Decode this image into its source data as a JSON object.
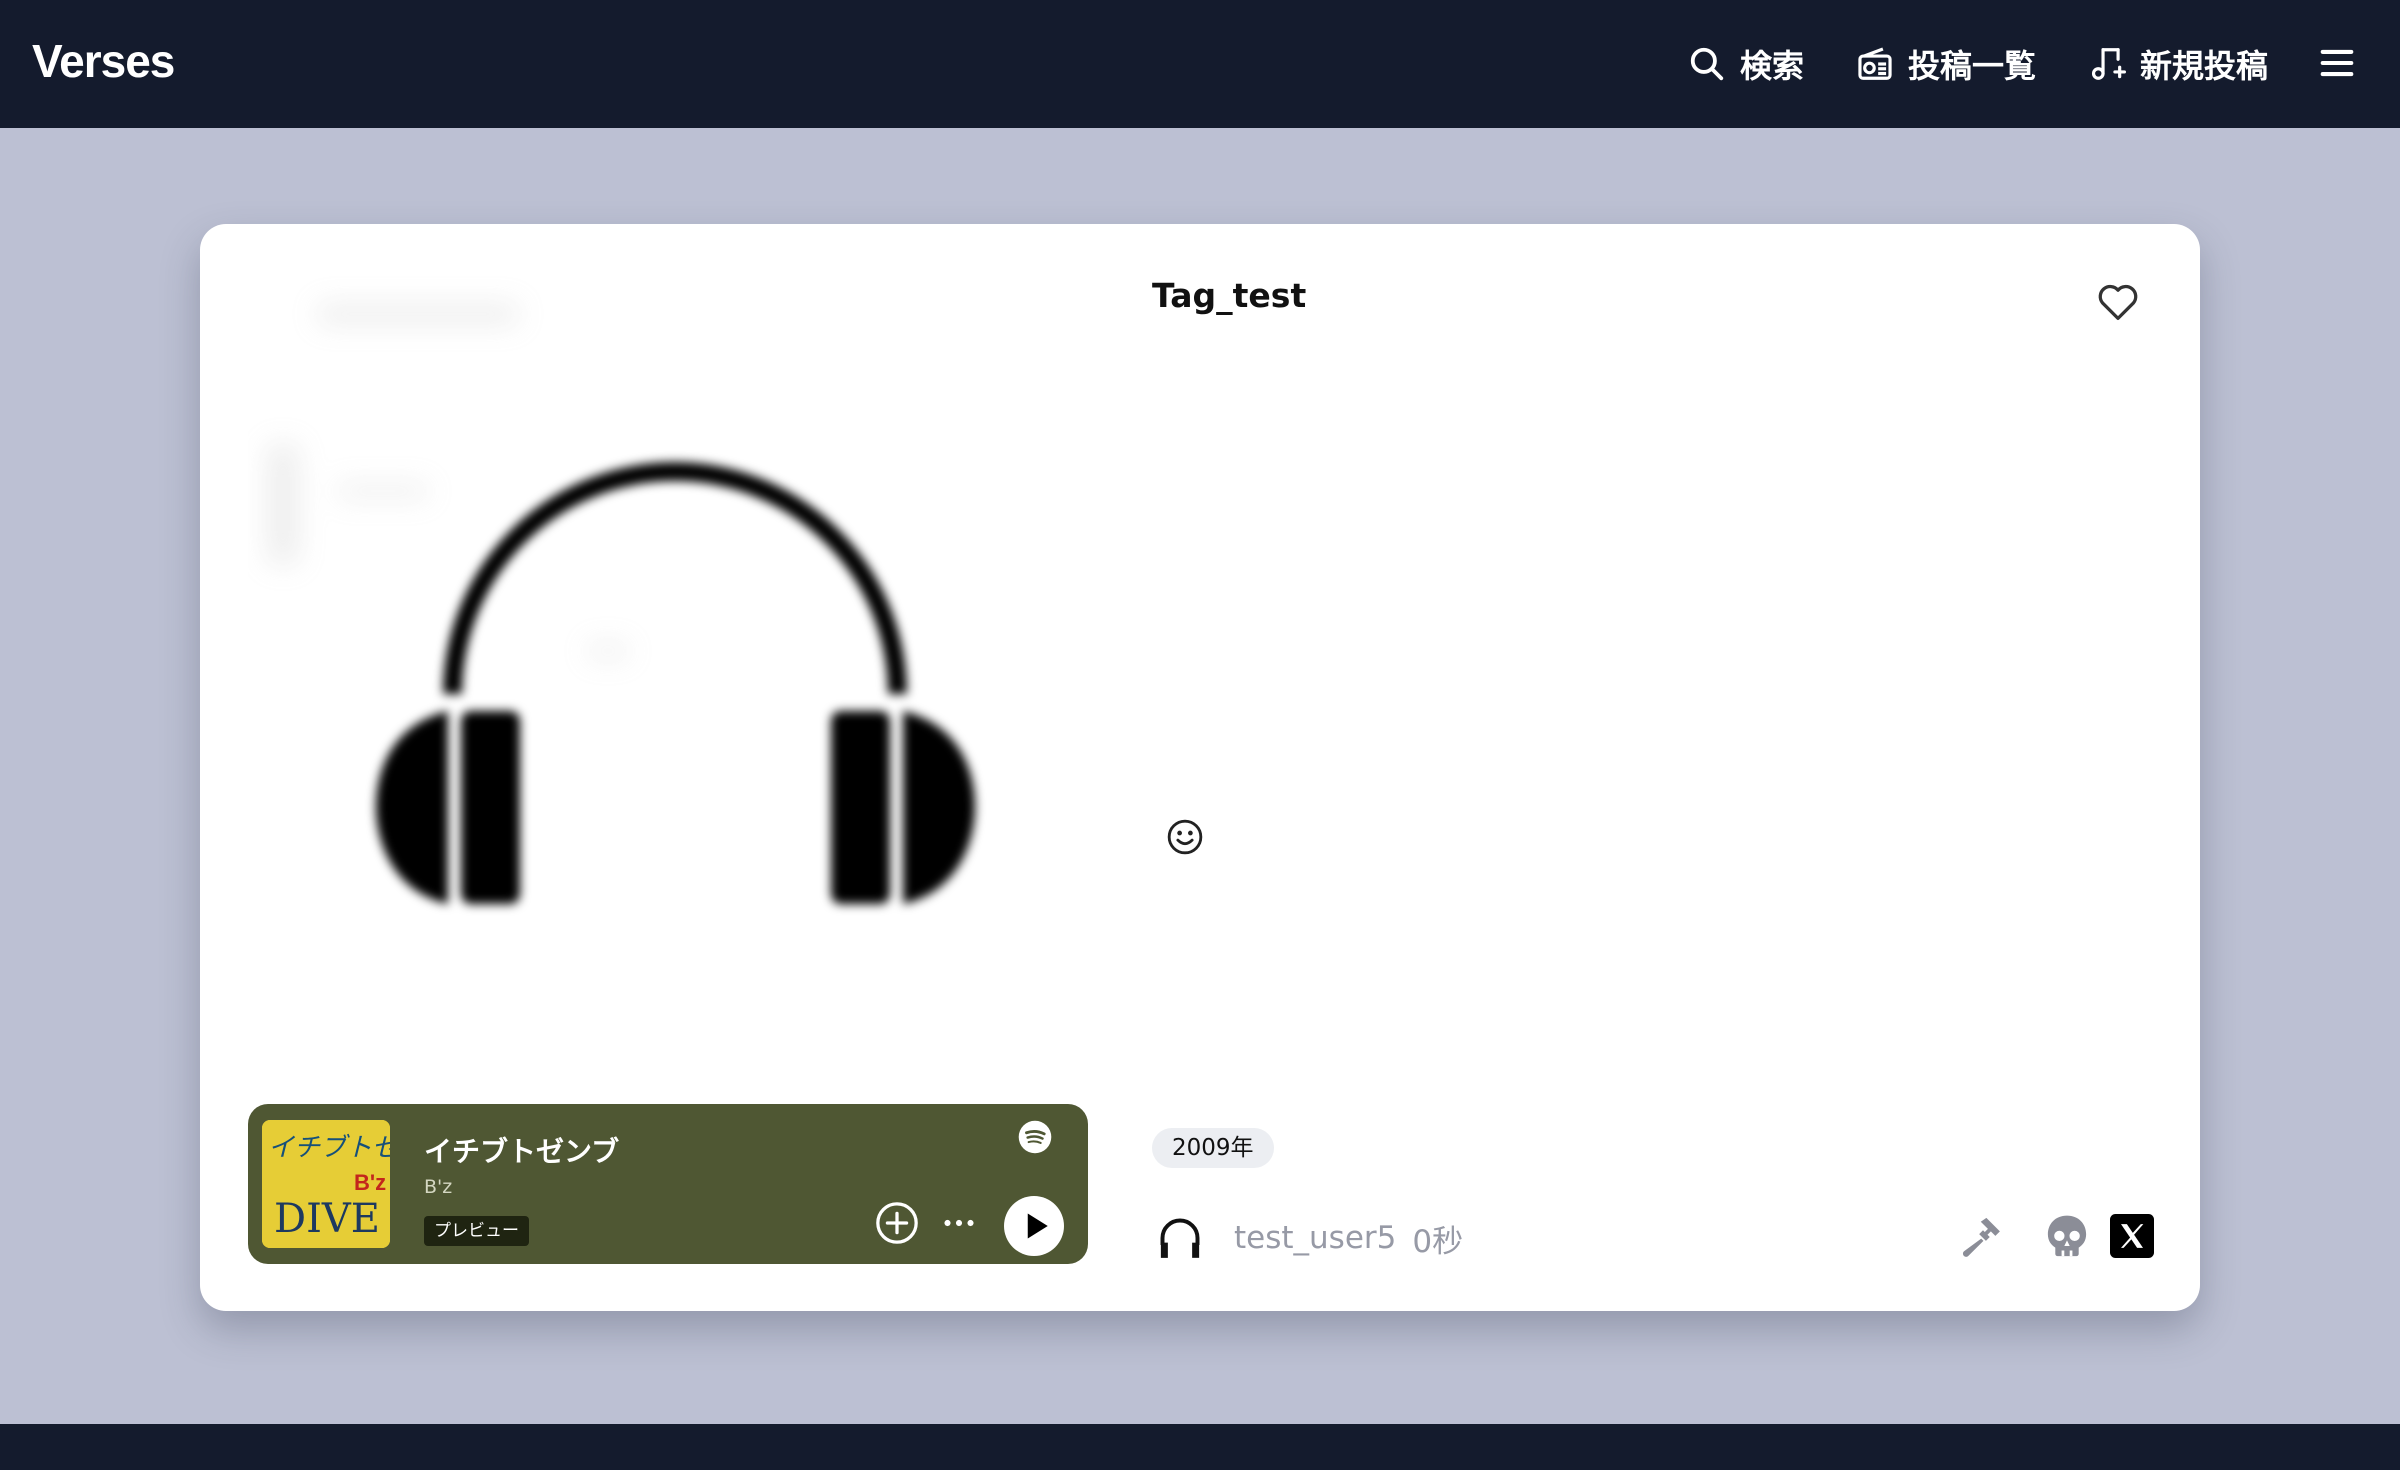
{
  "navbar": {
    "brand": "Verses",
    "search_label": "検索",
    "posts_label": "投稿一覧",
    "new_post_label": "新規投稿",
    "icons": [
      "search-icon",
      "radio-icon",
      "music-note-plus-icon",
      "menu-icon"
    ]
  },
  "post": {
    "title": "Tag_test",
    "tag": "2009年",
    "username": "test_user5",
    "time": "0秒",
    "artwork_icon": "headphones-icon",
    "icons": [
      "heart-icon",
      "smile-icon",
      "headphones-icon",
      "hammer-icon",
      "skull-icon",
      "x-logo-icon"
    ]
  },
  "player": {
    "track": "イチブトゼンブ",
    "artist": "B'z",
    "badge": "プレビュー",
    "cover_text_main": "イチブトゼンブ",
    "cover_text_sub": "DIVE",
    "cover_logo": "B'z",
    "icons": [
      "spotify-icon",
      "add-circle-icon",
      "more-icon",
      "play-icon"
    ],
    "background_color": "#4f5733"
  },
  "colors": {
    "navbar": "#141b2d",
    "page_background": "#bcc0d3",
    "muted_text": "#979aa6"
  }
}
